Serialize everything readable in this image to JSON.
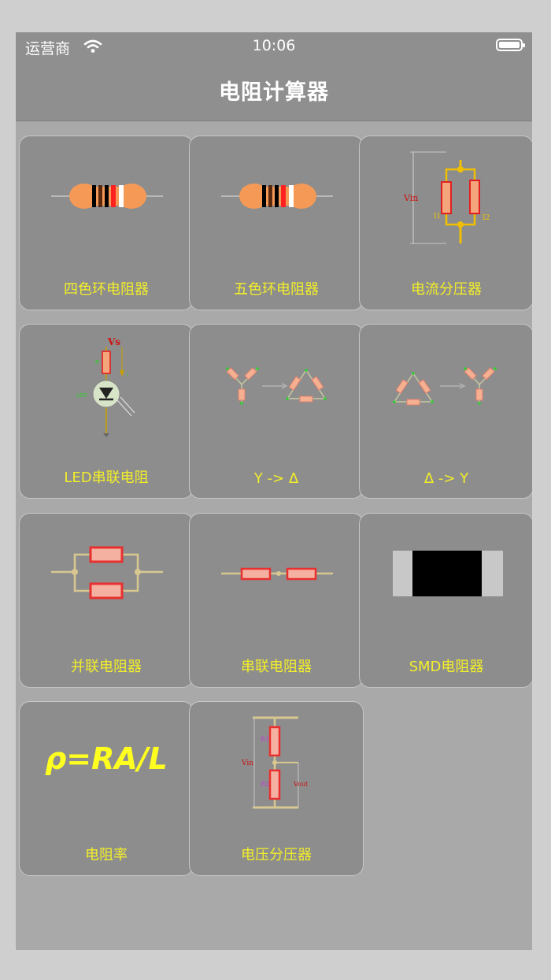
{
  "status_bar": {
    "carrier": "运营商",
    "time": "10:06"
  },
  "header": {
    "title": "电阻计算器"
  },
  "grid": {
    "items": [
      {
        "label": "四色环电阻器",
        "icon": "four-band-resistor-icon"
      },
      {
        "label": "五色环电阻器",
        "icon": "five-band-resistor-icon"
      },
      {
        "label": "电流分压器",
        "icon": "current-divider-icon",
        "diagram_text": {
          "vin": "Vin",
          "i1": "I1",
          "i2": "I2"
        }
      },
      {
        "label": "LED串联电阻",
        "icon": "led-series-resistor-icon",
        "diagram_text": {
          "vs": "Vs"
        }
      },
      {
        "label": "Y -> Δ",
        "icon": "wye-to-delta-icon"
      },
      {
        "label": "Δ -> Y",
        "icon": "delta-to-wye-icon"
      },
      {
        "label": "并联电阻器",
        "icon": "parallel-resistor-icon"
      },
      {
        "label": "串联电阻器",
        "icon": "series-resistor-icon"
      },
      {
        "label": "SMD电阻器",
        "icon": "smd-resistor-icon"
      },
      {
        "label": "电阻率",
        "icon": "resistivity-formula-icon",
        "formula": "ρ=RA/L"
      },
      {
        "label": "电压分压器",
        "icon": "voltage-divider-icon",
        "diagram_text": {
          "r1": "R1",
          "r2": "R2",
          "vin": "Vin",
          "vout": "Vout"
        }
      }
    ]
  },
  "colors": {
    "accent_label": "#f2ee2a",
    "tile_bg": "#8d8d8d",
    "nav_bg": "#8f8f8f",
    "page_bg": "#a9a9a9"
  }
}
